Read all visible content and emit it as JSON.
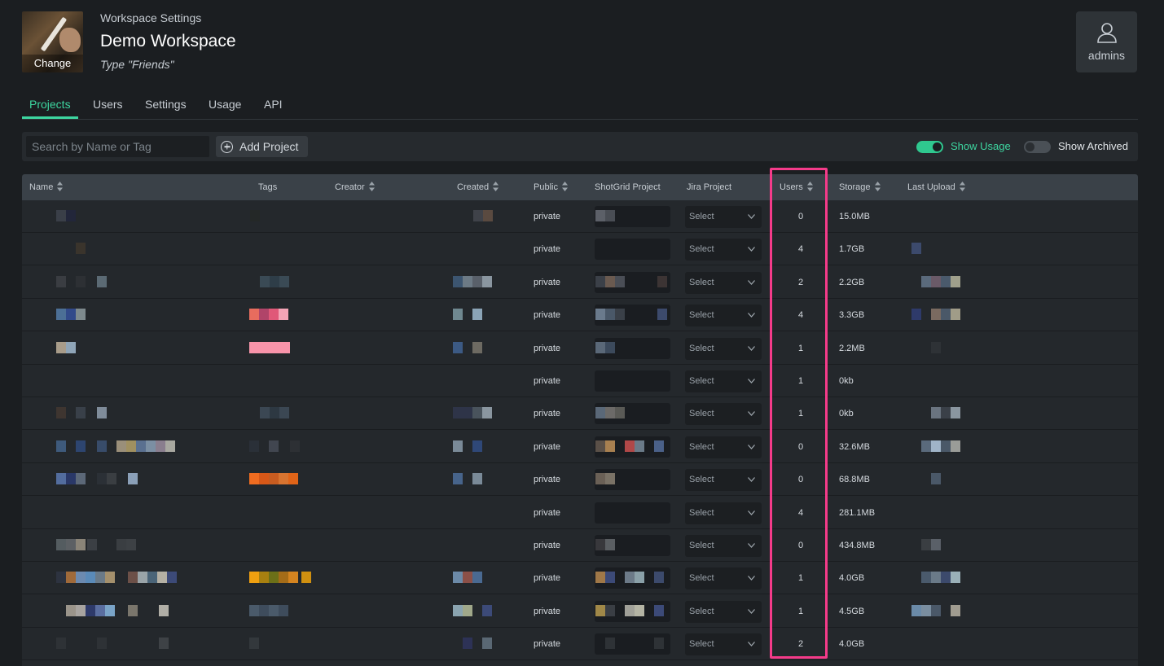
{
  "header": {
    "thumbnail_label": "Change",
    "section_label": "Workspace Settings",
    "workspace_name": "Demo Workspace",
    "workspace_type": "Type \"Friends\"",
    "admins_label": "admins"
  },
  "tabs": [
    {
      "label": "Projects",
      "active": true
    },
    {
      "label": "Users",
      "active": false
    },
    {
      "label": "Settings",
      "active": false
    },
    {
      "label": "Usage",
      "active": false
    },
    {
      "label": "API",
      "active": false
    }
  ],
  "toolbar": {
    "search_placeholder": "Search by Name or Tag",
    "add_project_label": "Add Project",
    "show_usage_label": "Show Usage",
    "show_usage_on": true,
    "show_archived_label": "Show Archived",
    "show_archived_on": false
  },
  "colors": {
    "accent": "#3dd6a0",
    "highlight": "#f53b8a",
    "background": "#1b1e21"
  },
  "table": {
    "columns": [
      {
        "label": "Name",
        "sortable": true
      },
      {
        "label": "Tags",
        "sortable": false
      },
      {
        "label": "Creator",
        "sortable": true
      },
      {
        "label": "Created",
        "sortable": true
      },
      {
        "label": "Public",
        "sortable": true
      },
      {
        "label": "ShotGrid Project",
        "sortable": false
      },
      {
        "label": "Jira Project",
        "sortable": false
      },
      {
        "label": "Users",
        "sortable": true
      },
      {
        "label": "Storage",
        "sortable": true
      },
      {
        "label": "Last Upload",
        "sortable": true
      }
    ],
    "select_placeholder": "Select",
    "rows": [
      {
        "public": "private",
        "users": "0",
        "storage": "15.0MB"
      },
      {
        "public": "private",
        "users": "4",
        "storage": "1.7GB"
      },
      {
        "public": "private",
        "users": "2",
        "storage": "2.2GB"
      },
      {
        "public": "private",
        "users": "4",
        "storage": "3.3GB"
      },
      {
        "public": "private",
        "users": "1",
        "storage": "2.2MB"
      },
      {
        "public": "private",
        "users": "1",
        "storage": "0kb"
      },
      {
        "public": "private",
        "users": "1",
        "storage": "0kb"
      },
      {
        "public": "private",
        "users": "0",
        "storage": "32.6MB"
      },
      {
        "public": "private",
        "users": "0",
        "storage": "68.8MB"
      },
      {
        "public": "private",
        "users": "4",
        "storage": "281.1MB"
      },
      {
        "public": "private",
        "users": "0",
        "storage": "434.8MB"
      },
      {
        "public": "private",
        "users": "1",
        "storage": "4.0GB"
      },
      {
        "public": "private",
        "users": "1",
        "storage": "4.5GB"
      },
      {
        "public": "private",
        "users": "2",
        "storage": "4.0GB"
      }
    ]
  }
}
